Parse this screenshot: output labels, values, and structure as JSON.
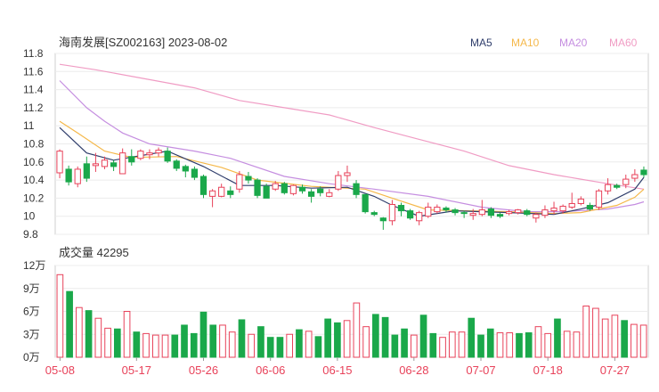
{
  "chart_data": [
    {
      "type": "candlestick",
      "title": "海南发展[SZ002163] 2023-08-02",
      "legend": [
        {
          "name": "MA5",
          "color": "#2f3d6b"
        },
        {
          "name": "MA10",
          "color": "#f5b84a"
        },
        {
          "name": "MA20",
          "color": "#c58ee0"
        },
        {
          "name": "MA60",
          "color": "#f09cc4"
        }
      ],
      "y_ticks": [
        "11.8",
        "11.6",
        "11.4",
        "11.2",
        "11",
        "10.8",
        "10.6",
        "10.4",
        "10.2",
        "10",
        "9.8"
      ],
      "ylim": [
        9.8,
        11.8
      ],
      "candles": [
        [
          10.48,
          10.72,
          10.42,
          10.74
        ],
        [
          10.52,
          10.38,
          10.34,
          10.56
        ],
        [
          10.36,
          10.52,
          10.32,
          10.55
        ],
        [
          10.58,
          10.42,
          10.38,
          10.66
        ],
        [
          10.56,
          10.58,
          10.49,
          10.7
        ],
        [
          10.55,
          10.62,
          10.52,
          10.66
        ],
        [
          10.59,
          10.55,
          10.5,
          10.62
        ],
        [
          10.47,
          10.7,
          10.47,
          10.75
        ],
        [
          10.66,
          10.6,
          10.56,
          10.74
        ],
        [
          10.64,
          10.72,
          10.62,
          10.74
        ],
        [
          10.68,
          10.7,
          10.63,
          10.74
        ],
        [
          10.7,
          10.73,
          10.66,
          10.76
        ],
        [
          10.72,
          10.61,
          10.59,
          10.76
        ],
        [
          10.61,
          10.53,
          10.5,
          10.63
        ],
        [
          10.55,
          10.5,
          10.43,
          10.57
        ],
        [
          10.52,
          10.43,
          10.4,
          10.55
        ],
        [
          10.44,
          10.24,
          10.2,
          10.46
        ],
        [
          10.22,
          10.28,
          10.1,
          10.3
        ],
        [
          10.22,
          10.32,
          10.21,
          10.36
        ],
        [
          10.28,
          10.24,
          10.2,
          10.33
        ],
        [
          10.3,
          10.46,
          10.26,
          10.5
        ],
        [
          10.44,
          10.4,
          10.36,
          10.49
        ],
        [
          10.4,
          10.23,
          10.2,
          10.42
        ],
        [
          10.33,
          10.2,
          10.2,
          10.36
        ],
        [
          10.3,
          10.36,
          10.28,
          10.39
        ],
        [
          10.36,
          10.26,
          10.24,
          10.38
        ],
        [
          10.25,
          10.34,
          10.23,
          10.35
        ],
        [
          10.32,
          10.28,
          10.25,
          10.35
        ],
        [
          10.27,
          10.22,
          10.15,
          10.3
        ],
        [
          10.3,
          10.26,
          10.22,
          10.33
        ],
        [
          10.22,
          10.26,
          10.21,
          10.3
        ],
        [
          10.3,
          10.45,
          10.28,
          10.5
        ],
        [
          10.45,
          10.48,
          10.38,
          10.56
        ],
        [
          10.36,
          10.24,
          10.2,
          10.4
        ],
        [
          10.24,
          10.05,
          10.03,
          10.24
        ],
        [
          10.04,
          10.02,
          10.0,
          10.06
        ],
        [
          9.98,
          9.95,
          9.85,
          9.99
        ],
        [
          9.95,
          10.13,
          9.9,
          10.18
        ],
        [
          10.12,
          10.06,
          10.0,
          10.15
        ],
        [
          10.06,
          9.98,
          9.96,
          10.08
        ],
        [
          9.95,
          10.04,
          9.9,
          10.06
        ],
        [
          10.0,
          10.1,
          9.98,
          10.15
        ],
        [
          10.05,
          10.1,
          10.03,
          10.13
        ],
        [
          10.09,
          10.07,
          10.04,
          10.11
        ],
        [
          10.07,
          10.04,
          10.01,
          10.09
        ],
        [
          10.04,
          10.03,
          9.98,
          10.06
        ],
        [
          10.01,
          10.03,
          9.96,
          10.08
        ],
        [
          10.02,
          10.07,
          10.0,
          10.18
        ],
        [
          10.08,
          10.01,
          9.98,
          10.1
        ],
        [
          10.02,
          10.0,
          9.98,
          10.04
        ],
        [
          10.03,
          10.05,
          10.01,
          10.07
        ],
        [
          10.04,
          10.07,
          10.02,
          10.08
        ],
        [
          10.06,
          10.02,
          10.0,
          10.08
        ],
        [
          9.98,
          10.02,
          9.93,
          10.04
        ],
        [
          10.01,
          10.07,
          9.98,
          10.12
        ],
        [
          10.06,
          10.09,
          10.02,
          10.16
        ],
        [
          10.06,
          10.11,
          10.03,
          10.13
        ],
        [
          10.1,
          10.14,
          10.08,
          10.26
        ],
        [
          10.14,
          10.19,
          10.12,
          10.22
        ],
        [
          10.12,
          10.08,
          10.06,
          10.15
        ],
        [
          10.1,
          10.28,
          10.07,
          10.3
        ],
        [
          10.28,
          10.35,
          10.24,
          10.42
        ],
        [
          10.34,
          10.32,
          10.3,
          10.36
        ],
        [
          10.35,
          10.41,
          10.31,
          10.46
        ],
        [
          10.42,
          10.46,
          10.38,
          10.52
        ],
        [
          10.51,
          10.46,
          10.43,
          10.55
        ]
      ],
      "ma5": [
        [
          0,
          10.98
        ],
        [
          3,
          10.7
        ],
        [
          6,
          10.62
        ],
        [
          12,
          10.72
        ],
        [
          16,
          10.55
        ],
        [
          20,
          10.34
        ],
        [
          24,
          10.34
        ],
        [
          28,
          10.31
        ],
        [
          32,
          10.32
        ],
        [
          35,
          10.22
        ],
        [
          37,
          10.12
        ],
        [
          40,
          10.0
        ],
        [
          44,
          10.06
        ],
        [
          50,
          10.04
        ],
        [
          55,
          10.02
        ],
        [
          58,
          10.08
        ],
        [
          61,
          10.15
        ],
        [
          64,
          10.3
        ],
        [
          65,
          10.43
        ]
      ],
      "ma10": [
        [
          0,
          11.05
        ],
        [
          2,
          10.92
        ],
        [
          5,
          10.72
        ],
        [
          8,
          10.65
        ],
        [
          13,
          10.66
        ],
        [
          18,
          10.54
        ],
        [
          22,
          10.4
        ],
        [
          28,
          10.33
        ],
        [
          34,
          10.3
        ],
        [
          37,
          10.2
        ],
        [
          41,
          10.07
        ],
        [
          50,
          10.05
        ],
        [
          55,
          10.03
        ],
        [
          58,
          10.04
        ],
        [
          62,
          10.12
        ],
        [
          64,
          10.21
        ],
        [
          65,
          10.3
        ]
      ],
      "ma20": [
        [
          0,
          11.5
        ],
        [
          3,
          11.2
        ],
        [
          5,
          11.05
        ],
        [
          7,
          10.92
        ],
        [
          10,
          10.8
        ],
        [
          15,
          10.72
        ],
        [
          19,
          10.64
        ],
        [
          25,
          10.44
        ],
        [
          30,
          10.36
        ],
        [
          35,
          10.3
        ],
        [
          41,
          10.22
        ],
        [
          47,
          10.1
        ],
        [
          52,
          10.05
        ],
        [
          56,
          10.05
        ],
        [
          61,
          10.08
        ],
        [
          64,
          10.13
        ],
        [
          65,
          10.16
        ]
      ],
      "ma60": [
        [
          0,
          11.68
        ],
        [
          4,
          11.62
        ],
        [
          10,
          11.51
        ],
        [
          15,
          11.42
        ],
        [
          20,
          11.28
        ],
        [
          25,
          11.2
        ],
        [
          30,
          11.12
        ],
        [
          35,
          10.98
        ],
        [
          40,
          10.85
        ],
        [
          45,
          10.72
        ],
        [
          50,
          10.56
        ],
        [
          55,
          10.46
        ],
        [
          58,
          10.41
        ],
        [
          61,
          10.36
        ],
        [
          65,
          10.3
        ]
      ]
    },
    {
      "type": "bar",
      "title": "成交量 42295",
      "y_ticks": [
        "12万",
        "9万",
        "6万",
        "3万",
        "0万"
      ],
      "ylim": [
        0,
        120000
      ],
      "x_tick_labels": [
        "05-08",
        "05-17",
        "05-26",
        "06-06",
        "06-15",
        "06-28",
        "07-07",
        "07-18",
        "07-27"
      ],
      "x_tick_indices": [
        0,
        8,
        15,
        22,
        29,
        37,
        44,
        51,
        58
      ],
      "volume": [
        108000,
        86000,
        65000,
        61000,
        51000,
        38000,
        37000,
        60000,
        33000,
        31000,
        29000,
        29000,
        29000,
        42000,
        31000,
        59000,
        42000,
        42000,
        33000,
        49000,
        30000,
        40000,
        26000,
        26000,
        30000,
        36000,
        34000,
        27000,
        50000,
        45000,
        48000,
        71000,
        40000,
        56000,
        52000,
        29000,
        37000,
        29000,
        55000,
        31000,
        26000,
        33000,
        33000,
        51000,
        29000,
        37000,
        32000,
        32000,
        31000,
        32000,
        40000,
        31000,
        50000,
        34000,
        33000,
        67000,
        64000,
        50000,
        55000,
        48000,
        43000,
        42000
      ]
    }
  ]
}
